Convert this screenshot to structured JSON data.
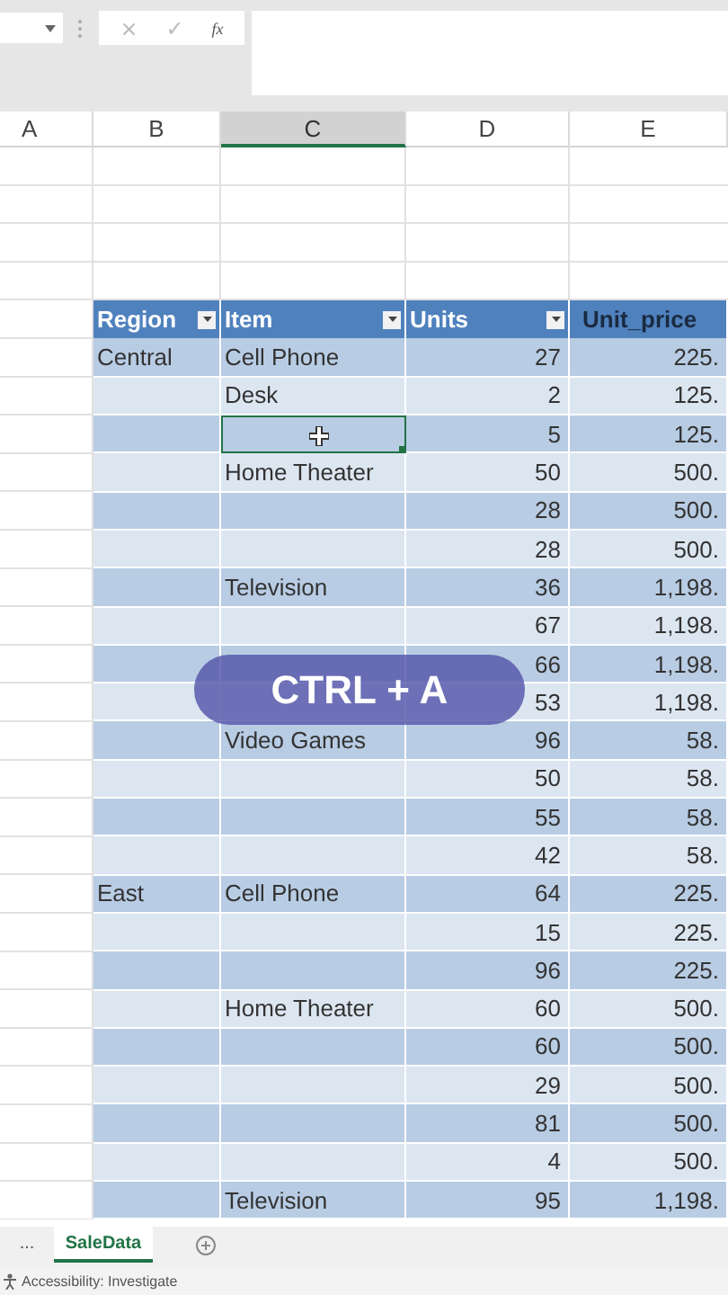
{
  "formula_bar": {
    "buttons": [
      "×",
      "✓",
      "fx"
    ]
  },
  "columns": [
    {
      "letter": "A",
      "selected": false
    },
    {
      "letter": "B",
      "selected": false
    },
    {
      "letter": "C",
      "selected": true
    },
    {
      "letter": "D",
      "selected": false
    },
    {
      "letter": "E",
      "selected": false
    }
  ],
  "table": {
    "headers": [
      {
        "label": "Region",
        "dark": false
      },
      {
        "label": "Item",
        "dark": false
      },
      {
        "label": "Units",
        "dark": false
      },
      {
        "label": "Unit_price",
        "dark": true
      }
    ],
    "rows": [
      {
        "region": "Central",
        "item": "Cell Phone",
        "units": "27",
        "unit_price": "225.",
        "selected": false
      },
      {
        "item": "Desk",
        "units": "2",
        "unit_price": "125.",
        "selected": false
      },
      {
        "units": "5",
        "unit_price": "125.",
        "selected": true
      },
      {
        "item": "Home Theater",
        "units": "50",
        "unit_price": "500.",
        "selected": false
      },
      {
        "units": "28",
        "unit_price": "500.",
        "selected": false
      },
      {
        "units": "28",
        "unit_price": "500.",
        "selected": false
      },
      {
        "item": "Television",
        "units": "36",
        "unit_price": "1,198.",
        "selected": false
      },
      {
        "units": "67",
        "unit_price": "1,198.",
        "selected": false
      },
      {
        "units": "66",
        "unit_price": "1,198.",
        "selected": false
      },
      {
        "units": "53",
        "unit_price": "1,198.",
        "selected": false
      },
      {
        "item": "Video Games",
        "units": "96",
        "unit_price": "58.",
        "selected": false
      },
      {
        "units": "50",
        "unit_price": "58.",
        "selected": false
      },
      {
        "units": "55",
        "unit_price": "58.",
        "selected": false
      },
      {
        "units": "42",
        "unit_price": "58.",
        "selected": false
      },
      {
        "region": "East",
        "item": "Cell Phone",
        "units": "64",
        "unit_price": "225.",
        "selected": false
      },
      {
        "units": "15",
        "unit_price": "225.",
        "selected": false
      },
      {
        "units": "96",
        "unit_price": "225.",
        "selected": false
      },
      {
        "item": "Home Theater",
        "units": "60",
        "unit_price": "500.",
        "selected": false
      },
      {
        "units": "60",
        "unit_price": "500.",
        "selected": false
      },
      {
        "units": "29",
        "unit_price": "500.",
        "selected": false
      },
      {
        "units": "81",
        "unit_price": "500.",
        "selected": false
      },
      {
        "units": "4",
        "unit_price": "500.",
        "selected": false
      },
      {
        "item": "Television",
        "units": "95",
        "unit_price": "1,198.",
        "selected": false
      }
    ]
  },
  "overlay": {
    "text": "CTRL + A"
  },
  "sheet_tabs": {
    "more": "...",
    "tabs": [
      {
        "label": "SaleData",
        "selected": true
      }
    ]
  },
  "status_bar": {
    "text": "Accessibility: Investigate"
  }
}
